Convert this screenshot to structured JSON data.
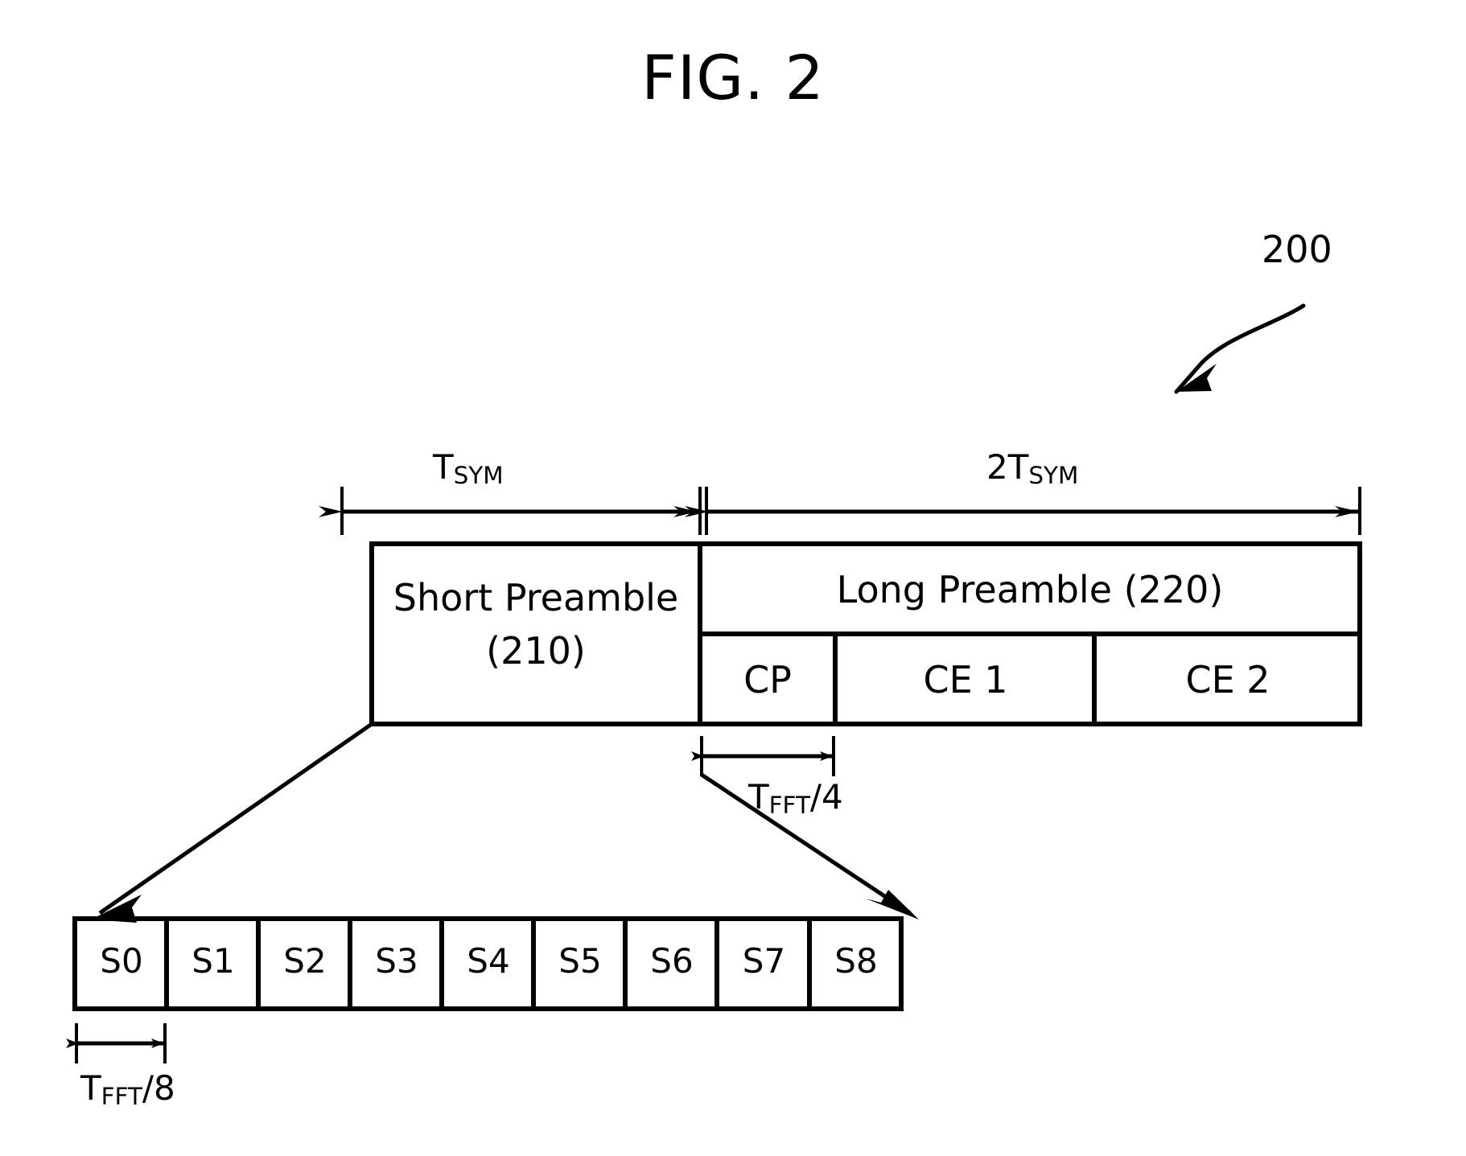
{
  "figure": {
    "title": "FIG. 2",
    "reference_numeral": "200"
  },
  "dimensions": {
    "tsym": {
      "base": "T",
      "sub": "SYM",
      "full": "TSYM"
    },
    "two_tsym": {
      "prefix": "2",
      "base": "T",
      "sub": "SYM",
      "full": "2TSYM"
    },
    "tfft_over_4": {
      "base": "T",
      "sub": "FFT",
      "suffix": "/4",
      "full": "TFFT/4"
    },
    "tfft_over_8": {
      "base": "T",
      "sub": "FFT",
      "suffix": "/8",
      "full": "TFFT/8"
    }
  },
  "frame": {
    "short_preamble": {
      "line1": "Short Preamble",
      "line2": "(210)"
    },
    "long_preamble": {
      "header": "Long Preamble (220)",
      "cells": [
        {
          "label": "CP"
        },
        {
          "label": "CE 1"
        },
        {
          "label": "CE 2"
        }
      ]
    }
  },
  "short_preamble_detail": {
    "cells": [
      {
        "label": "S0"
      },
      {
        "label": "S1"
      },
      {
        "label": "S2"
      },
      {
        "label": "S3"
      },
      {
        "label": "S4"
      },
      {
        "label": "S5"
      },
      {
        "label": "S6"
      },
      {
        "label": "S7"
      },
      {
        "label": "S8"
      }
    ]
  },
  "style": {
    "ink": "#000000",
    "paper": "#ffffff"
  }
}
